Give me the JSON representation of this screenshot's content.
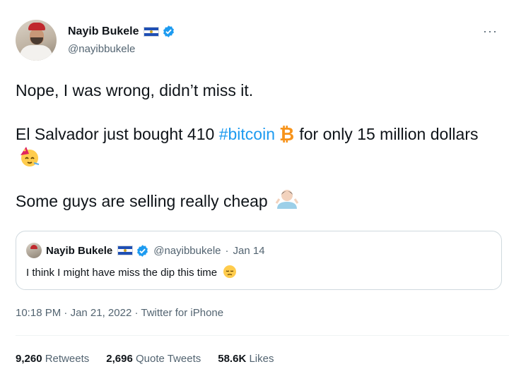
{
  "author": {
    "name": "Nayib Bukele",
    "handle": "@nayibbukele",
    "flag_icon": "el-salvador-flag-icon",
    "verified_icon": "verified-badge-icon",
    "more_label": "···"
  },
  "tweet": {
    "line1": "Nope, I was wrong, didn’t miss it.",
    "line2_a": "El Salvador just bought 410 ",
    "hashtag": "#bitcoin",
    "line2_b": " for only 15 million dollars",
    "line3": "Some guys are selling really cheap"
  },
  "quoted": {
    "name": "Nayib Bukele",
    "handle": "@nayibbukele",
    "sep": "·",
    "date": "Jan 14",
    "text": "I think I might have miss the dip this time"
  },
  "meta": {
    "time": "10:18 PM",
    "date": "Jan 21, 2022",
    "client": "Twitter for iPhone",
    "sep": "·"
  },
  "stats": {
    "retweets_count": "9,260",
    "retweets_label": "Retweets",
    "quotes_count": "2,696",
    "quotes_label": "Quote Tweets",
    "likes_count": "58.6K",
    "likes_label": "Likes"
  },
  "colors": {
    "link": "#1d9bf0",
    "secondary": "#536471",
    "border": "#cfd9de"
  }
}
